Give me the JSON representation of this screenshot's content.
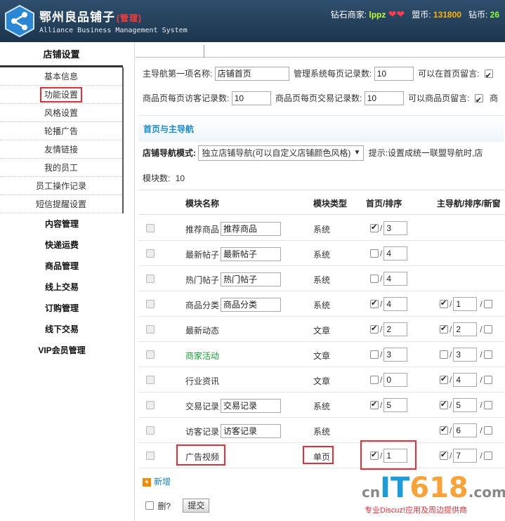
{
  "header": {
    "title": "鄂州良品铺子",
    "title_tag": "(管理)",
    "subtitle": "Alliance Business Management System",
    "level_label": "钻石商家:",
    "username": "lppz",
    "hearts": "❤❤",
    "alliance_coin_label": "盟币:",
    "alliance_coin": "131800",
    "coin_label": "钻币:",
    "coin": "26"
  },
  "sidebar": {
    "section_title": "店铺设置",
    "sub_items": [
      {
        "label": "基本信息"
      },
      {
        "label": "功能设置",
        "active": true
      },
      {
        "label": "风格设置"
      },
      {
        "label": "轮播广告"
      },
      {
        "label": "友情链接"
      },
      {
        "label": "我的员工"
      },
      {
        "label": "员工操作记录"
      },
      {
        "label": "短信提醒设置"
      }
    ],
    "categories": [
      {
        "label": "内容管理"
      },
      {
        "label": "快递运费"
      },
      {
        "label": "商品管理"
      },
      {
        "label": "线上交易"
      },
      {
        "label": "订购管理"
      },
      {
        "label": "线下交易"
      },
      {
        "label": "VIP会员管理"
      }
    ]
  },
  "settings": {
    "nav_first_label": "主导航第一项名称:",
    "nav_first_value": "店铺首页",
    "records_per_page_label": "管理系统每页记录数:",
    "records_per_page_value": "10",
    "home_comment_label": "可以在首页留言:",
    "visitor_records_label": "商品页每页访客记录数:",
    "visitor_records_value": "10",
    "trade_records_label": "商品页每页交易记录数:",
    "trade_records_value": "10",
    "product_comment_label": "可以商品页留言:",
    "product_comment_tail": "商"
  },
  "section": {
    "title": "首页与主导航",
    "nav_mode_label": "店铺导航模式:",
    "nav_mode_value": "独立店铺导航(可以自定义店铺颜色风格)",
    "hint": "提示:设置成统一联盟导航时,店",
    "module_count_label": "模块数:",
    "module_count": "10"
  },
  "table": {
    "headers": {
      "name": "模块名称",
      "type": "模块类型",
      "home": "首页/排序",
      "nav": "主导航/排序/新窗"
    },
    "rows": [
      {
        "name": "推荐商品",
        "alias": "推荐商品",
        "has_input": true,
        "type": "系统",
        "home_on": true,
        "home_sort": "3",
        "show_nav": false
      },
      {
        "name": "最新帖子",
        "alias": "最新帖子",
        "has_input": true,
        "type": "系统",
        "home_on": false,
        "home_sort": "4",
        "show_nav": false
      },
      {
        "name": "热门帖子",
        "alias": "热门帖子",
        "has_input": true,
        "type": "系统",
        "home_on": false,
        "home_sort": "4",
        "show_nav": false
      },
      {
        "name": "商品分类",
        "alias": "商品分类",
        "has_input": true,
        "type": "系统",
        "home_on": true,
        "home_sort": "4",
        "show_nav": true,
        "nav_on": true,
        "nav_sort": "1"
      },
      {
        "name": "最新动态",
        "alias": "",
        "has_input": false,
        "type": "文章",
        "home_on": true,
        "home_sort": "2",
        "show_nav": true,
        "nav_on": true,
        "nav_sort": "2"
      },
      {
        "name": "商家活动",
        "alias": "",
        "has_input": false,
        "green": true,
        "type": "文章",
        "home_on": false,
        "home_sort": "3",
        "show_nav": true,
        "nav_on": false,
        "nav_sort": "3"
      },
      {
        "name": "行业资讯",
        "alias": "",
        "has_input": false,
        "type": "文章",
        "home_on": false,
        "home_sort": "0",
        "show_nav": true,
        "nav_on": true,
        "nav_sort": "4"
      },
      {
        "name": "交易记录",
        "alias": "交易记录",
        "has_input": true,
        "type": "系统",
        "home_on": true,
        "home_sort": "5",
        "show_nav": true,
        "nav_on": true,
        "nav_sort": "5"
      },
      {
        "name": "访客记录",
        "alias": "访客记录",
        "has_input": true,
        "type": "系统",
        "home_on": false,
        "home_sort": "",
        "show_nav": true,
        "nav_on": true,
        "nav_sort": "6",
        "no_home": true
      },
      {
        "name": "广告视频",
        "alias": "",
        "has_input": false,
        "type": "单页",
        "home_on": true,
        "home_sort": "1",
        "show_nav": true,
        "nav_on": true,
        "nav_sort": "7",
        "highlight": true
      }
    ]
  },
  "footer": {
    "add_label": "新增",
    "delete_label": "删?",
    "submit_label": "提交"
  },
  "watermark": {
    "cn": "cn",
    "it": "IT",
    "num": "618",
    "com": ".com",
    "tagline": "专业Discuz!应用及周边提供商"
  }
}
